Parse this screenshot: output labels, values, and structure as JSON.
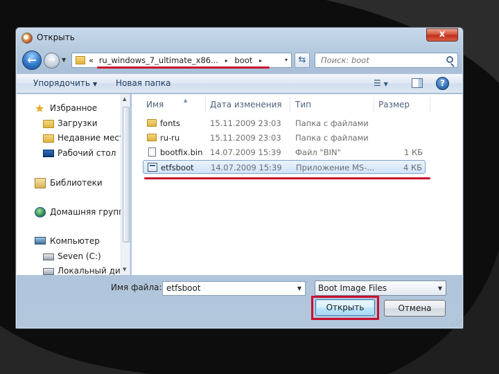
{
  "window": {
    "title": "Открыть",
    "close_symbol": "x"
  },
  "address_bar": {
    "overflow_chevron": "«",
    "path": [
      "ru_windows_7_ultimate_x86...",
      "boot"
    ],
    "separator": "▸",
    "dropdown": "▾"
  },
  "search": {
    "placeholder": "Поиск: boot"
  },
  "toolbar": {
    "organize_label": "Упорядочить",
    "new_folder_label": "Новая папка",
    "views_symbol": "☰",
    "help_symbol": "?"
  },
  "nav_pane": {
    "items": [
      {
        "label": "Избранное",
        "icon": "star-icon",
        "level": 0
      },
      {
        "label": "Загрузки",
        "icon": "downloads-folder-icon",
        "level": 1
      },
      {
        "label": "Недавние места",
        "icon": "recent-places-icon",
        "level": 1
      },
      {
        "label": "Рабочий стол",
        "icon": "desktop-icon",
        "level": 1
      },
      {
        "label": "Библиотеки",
        "icon": "libraries-icon",
        "level": 0
      },
      {
        "label": "Домашняя группа",
        "icon": "homegroup-icon",
        "level": 0
      },
      {
        "label": "Компьютер",
        "icon": "computer-icon",
        "level": 0
      },
      {
        "label": "Seven (C:)",
        "icon": "drive-icon",
        "level": 1
      },
      {
        "label": "Локальный диск",
        "icon": "drive-icon",
        "level": 1
      }
    ]
  },
  "file_list": {
    "columns": [
      "Имя",
      "Дата изменения",
      "Тип",
      "Размер"
    ],
    "rows": [
      {
        "name": "fonts",
        "date": "15.11.2009 23:03",
        "type": "Папка с файлами",
        "size": "",
        "icon": "folder-icon",
        "selected": false
      },
      {
        "name": "ru-ru",
        "date": "15.11.2009 23:03",
        "type": "Папка с файлами",
        "size": "",
        "icon": "folder-icon",
        "selected": false
      },
      {
        "name": "bootfix.bin",
        "date": "14.07.2009 15:39",
        "type": "Файл \"BIN\"",
        "size": "1 КБ",
        "icon": "file-icon",
        "selected": false
      },
      {
        "name": "etfsboot",
        "date": "14.07.2009 15:39",
        "type": "Приложение MS-...",
        "size": "4 КБ",
        "icon": "application-icon",
        "selected": true
      }
    ]
  },
  "bottom": {
    "filename_label": "Имя файла:",
    "filename_value": "etfsboot",
    "filetype_value": "Boot Image Files",
    "open_label": "Открыть",
    "cancel_label": "Отмена"
  },
  "colors": {
    "annotation_red": "#c8102e",
    "selection_blue": "#cfe4fa"
  }
}
